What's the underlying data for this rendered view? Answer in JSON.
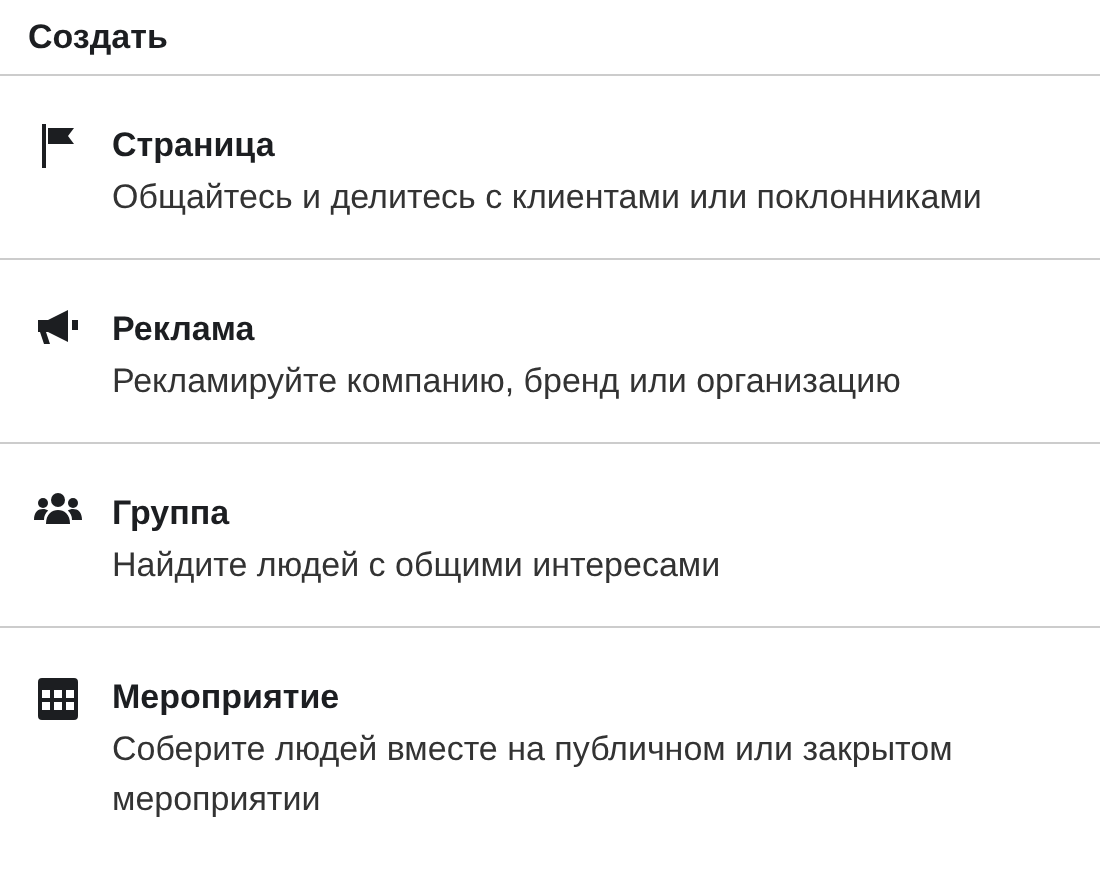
{
  "header": {
    "title": "Создать"
  },
  "items": [
    {
      "kind": "page",
      "title": "Страница",
      "description": "Общайтесь и делитесь с клиентами или поклонниками"
    },
    {
      "kind": "ad",
      "title": "Реклама",
      "description": "Рекламируйте компанию, бренд или организацию"
    },
    {
      "kind": "group",
      "title": "Группа",
      "description": "Найдите людей с общими интересами"
    },
    {
      "kind": "event",
      "title": "Мероприятие",
      "description": "Соберите людей вместе на публичном или закрытом мероприятии"
    }
  ]
}
